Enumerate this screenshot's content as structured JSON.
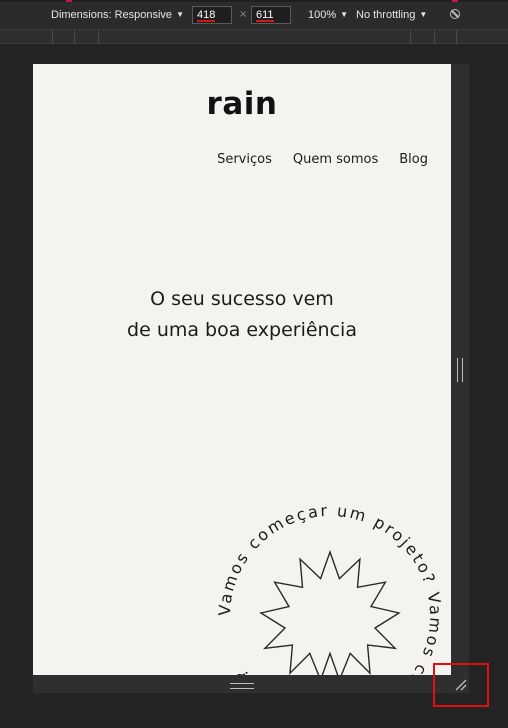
{
  "toolbar": {
    "dimensions_label": "Dimensions: Responsive",
    "width_value": "418",
    "height_value": "611",
    "times": "×",
    "zoom": "100%",
    "throttling": "No throttling",
    "rotate_icon": "no-connection-icon",
    "accent": "#d01818"
  },
  "page": {
    "logo": "rain",
    "nav": [
      "Serviços",
      "Quem somos",
      "Blog"
    ],
    "hero_line1": "O seu sucesso vem",
    "hero_line2": "de uma boa experiência",
    "circular_text": "Vamos começar um projeto? Vamos começar um projeto?",
    "background": "#f4f3ef"
  }
}
